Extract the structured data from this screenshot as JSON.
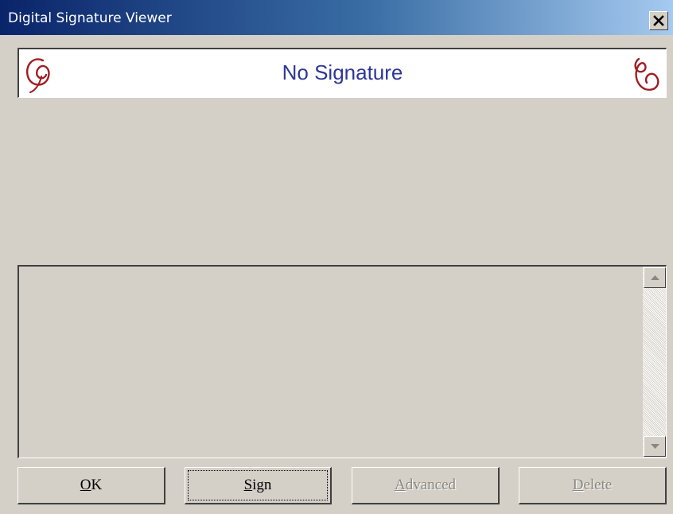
{
  "window": {
    "title": "Digital Signature Viewer",
    "close_glyph": "✕"
  },
  "banner": {
    "status_text": "No Signature",
    "status_color": "#2e3796",
    "logo_color": "#a01e24",
    "logo_left_icon": "signature-flourish-icon",
    "logo_right_icon": "signature-flourish-icon"
  },
  "details_panel": {
    "text": ""
  },
  "buttons": {
    "ok": {
      "label": "OK",
      "enabled": true
    },
    "sign": {
      "label": "Sign",
      "enabled": true,
      "focused": true
    },
    "advanced": {
      "label": "Advanced",
      "enabled": false
    },
    "delete": {
      "label": "Delete",
      "enabled": false
    }
  }
}
